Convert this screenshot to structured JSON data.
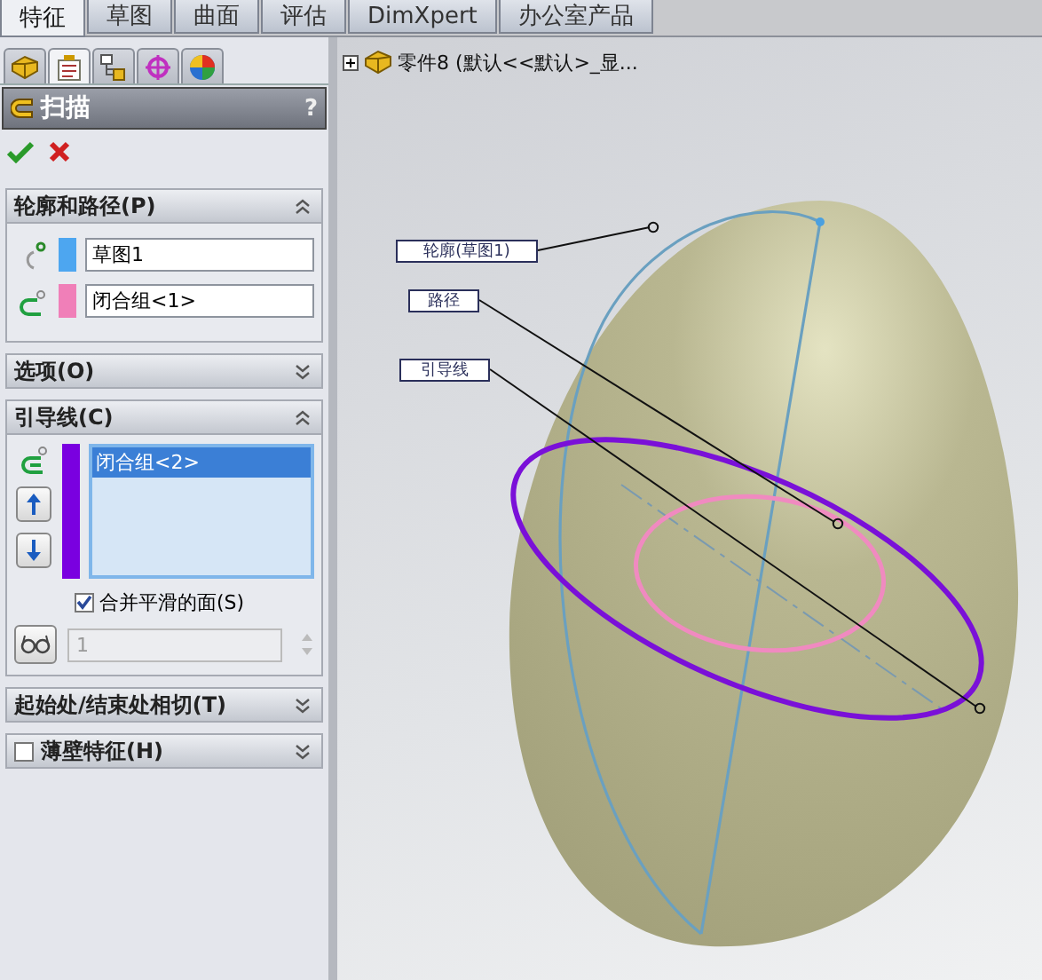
{
  "top_tabs": [
    {
      "label": "特征",
      "selected": true
    },
    {
      "label": "草图",
      "selected": false
    },
    {
      "label": "曲面",
      "selected": false
    },
    {
      "label": "评估",
      "selected": false
    },
    {
      "label": "DimXpert",
      "selected": false
    },
    {
      "label": "办公室产品",
      "selected": false
    }
  ],
  "panel_tabs": [
    {
      "kind": "tree",
      "selected": false
    },
    {
      "kind": "property",
      "selected": true
    },
    {
      "kind": "config",
      "selected": false
    },
    {
      "kind": "dim",
      "selected": false
    },
    {
      "kind": "display",
      "selected": false
    }
  ],
  "property_manager": {
    "title": "扫描",
    "help": "?"
  },
  "groups": [
    {
      "kind": "profile_path",
      "title": "轮廓和路径(P)",
      "expanded": true,
      "fields": [
        {
          "kind": "profile",
          "color": "#4da6f0",
          "value": "草图1"
        },
        {
          "kind": "path",
          "color": "#f07fb8",
          "value": "闭合组<1>"
        }
      ]
    },
    {
      "kind": "plain",
      "title": "选项(O)",
      "expanded": false
    },
    {
      "kind": "guides",
      "title": "引导线(C)",
      "expanded": true,
      "color": "#7a00e0",
      "items": [
        {
          "label": "闭合组<2>",
          "selected": true
        }
      ],
      "merge": {
        "label": "合并平滑的面(S)",
        "checked": true
      },
      "spin": {
        "value": "1",
        "disabled": true
      }
    },
    {
      "kind": "plain",
      "title": "起始处/结束处相切(T)",
      "expanded": false
    },
    {
      "kind": "check",
      "title": "薄壁特征(H)",
      "expanded": false,
      "checked": false
    }
  ],
  "tree": {
    "expanded": false,
    "label": "零件8  (默认<<默认>_显..."
  },
  "viewport": {
    "callouts": [
      {
        "label": "轮廓(草图1)"
      },
      {
        "label": "路径"
      },
      {
        "label": "引导线"
      }
    ]
  }
}
